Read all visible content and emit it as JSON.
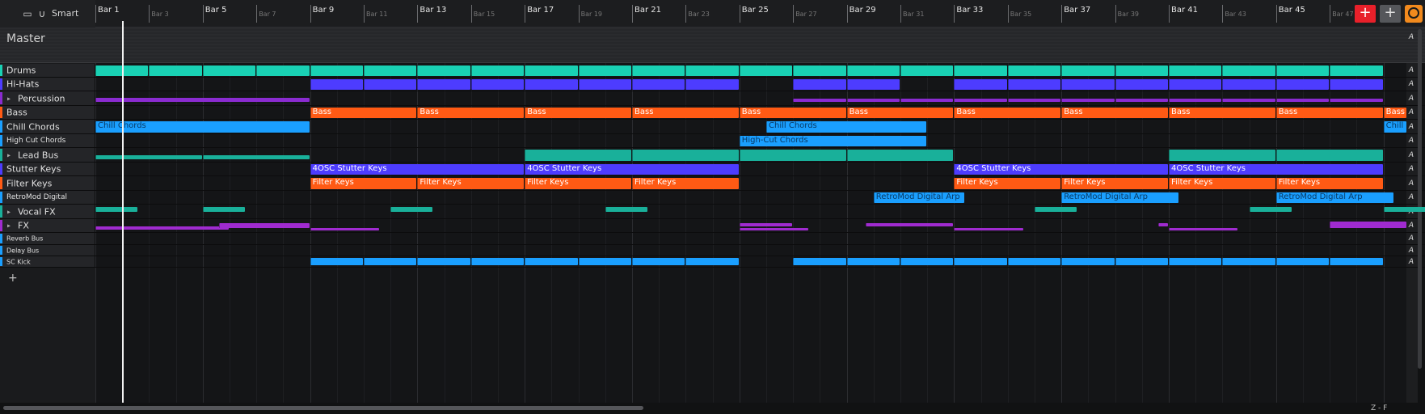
{
  "toolbar": {
    "smart_label": "Smart",
    "add_track_symbol": "+",
    "add_gray_symbol": "+"
  },
  "ruler": {
    "major": [
      "Bar 1",
      "Bar 9",
      "Bar 17",
      "Bar 25",
      "Bar 33",
      "Bar 41"
    ],
    "mid": [
      "Bar 5",
      "Bar 13",
      "Bar 21",
      "Bar 29",
      "Bar 37",
      "Bar 45"
    ],
    "minor": [
      "Bar 3",
      "Bar 7",
      "Bar 11",
      "Bar 15",
      "Bar 19",
      "Bar 23",
      "Bar 27",
      "Bar 31",
      "Bar 35",
      "Bar 39",
      "Bar 43",
      "Bar 47"
    ]
  },
  "master": {
    "label": "Master",
    "auto_label": "A"
  },
  "tracks": [
    {
      "name": "Drums",
      "color": "#19d1b4",
      "size": "normal",
      "fold": false
    },
    {
      "name": "Hi-Hats",
      "color": "#4d3cff",
      "size": "normal",
      "fold": false
    },
    {
      "name": "Percussion",
      "color": "#8a2bd0",
      "size": "normal",
      "fold": true
    },
    {
      "name": "Bass",
      "color": "#ff5a14",
      "size": "normal",
      "fold": false
    },
    {
      "name": "Chill Chords",
      "color": "#1a9fff",
      "size": "normal",
      "fold": false
    },
    {
      "name": "High Cut Chords",
      "color": "#1a9fff",
      "size": "small",
      "fold": false
    },
    {
      "name": "Lead Bus",
      "color": "#19b09a",
      "size": "normal",
      "fold": true
    },
    {
      "name": "Stutter Keys",
      "color": "#4d3cff",
      "size": "normal",
      "fold": false
    },
    {
      "name": "Filter Keys",
      "color": "#ff5a14",
      "size": "normal",
      "fold": false
    },
    {
      "name": "RetroMod Digital",
      "color": "#1a9fff",
      "size": "small",
      "fold": false
    },
    {
      "name": "Vocal FX",
      "color": "#19b09a",
      "size": "normal",
      "fold": true
    },
    {
      "name": "FX",
      "color": "#a02bd0",
      "size": "normal",
      "fold": true
    },
    {
      "name": "Reverb Bus",
      "color": "#1a9fff",
      "size": "tiny",
      "fold": false
    },
    {
      "name": "Delay Bus",
      "color": "#1a9fff",
      "size": "tiny",
      "fold": false
    },
    {
      "name": "SC Kick",
      "color": "#1a9fff",
      "size": "tiny",
      "fold": false
    }
  ],
  "clip_labels": {
    "bass": "Bass",
    "chill": "Chill Chords",
    "chill_cut": "Chill",
    "highcut": "High-Cut Chords",
    "stutter": "4OSC Stutter Keys",
    "filter": "Filter Keys",
    "retro": "RetroMod Digital Arp"
  },
  "colors": {
    "teal": "#19d1b4",
    "teal_dark": "#19b09a",
    "indigo": "#4d3cff",
    "purple": "#8a2bd0",
    "orange": "#ff5a14",
    "blue": "#1a9fff",
    "add_button": "#e8202a",
    "headset": "#f28a1d"
  },
  "icons": {
    "home": "inbox-icon",
    "snap": "magnet-icon",
    "add": "plus-icon",
    "headphones": "headphones-icon"
  },
  "footer": {
    "zoom_text": "Z - F"
  }
}
